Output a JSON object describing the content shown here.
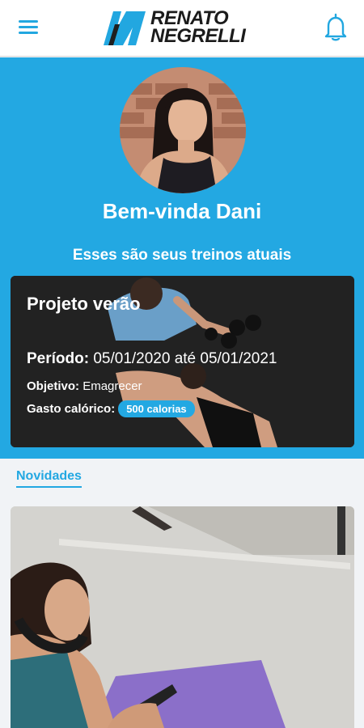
{
  "header": {
    "logo_line1": "RENATO",
    "logo_line2": "NEGRELLI",
    "menu_icon": "hamburger-menu-icon",
    "notification_icon": "bell-icon"
  },
  "hero": {
    "welcome": "Bem-vinda Dani",
    "subtitle": "Esses são seus treinos atuais"
  },
  "workout": {
    "title": "Projeto verão",
    "period_label": "Período:",
    "period_value": "05/01/2020 até 05/01/2021",
    "goal_label": "Objetivo:",
    "goal_value": "Emagrecer",
    "calories_label": "Gasto calórico:",
    "calories_value": "500 calorias"
  },
  "news": {
    "tab_label": "Novidades"
  },
  "colors": {
    "accent": "#23a8e2",
    "background": "#f1f3f6",
    "card_dark": "#232323"
  }
}
